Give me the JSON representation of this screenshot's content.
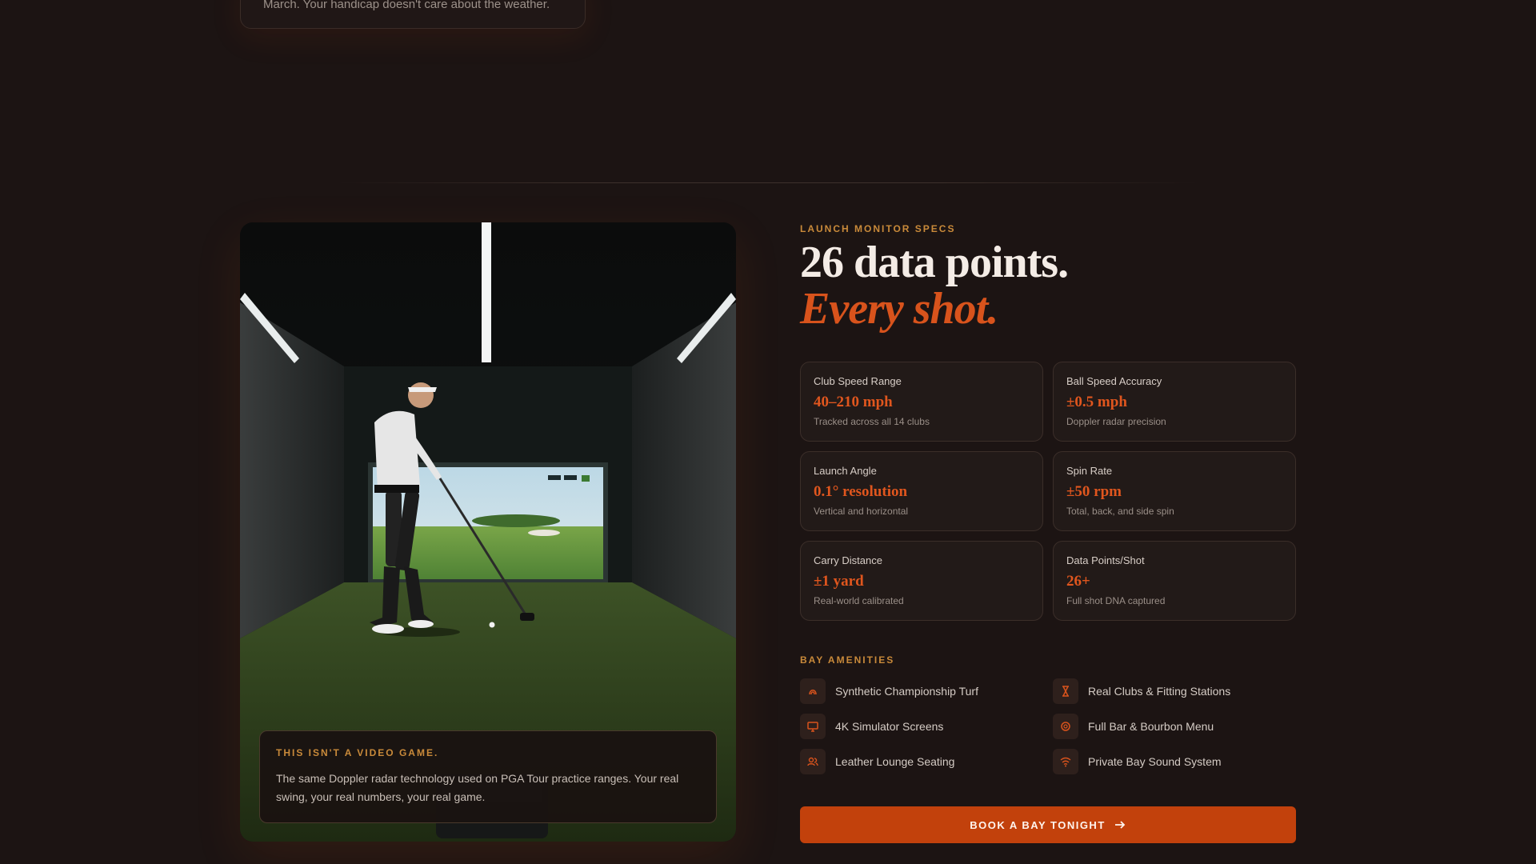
{
  "top_card": {
    "text": "March. Your handicap doesn't care about the weather."
  },
  "photo_callout": {
    "eyebrow": "THIS ISN'T A VIDEO GAME.",
    "body": "The same Doppler radar technology used on PGA Tour practice ranges. Your real swing, your real numbers, your real game."
  },
  "specs_section": {
    "eyebrow": "LAUNCH MONITOR SPECS",
    "headline": "26 data points.",
    "headline_accent": "Every shot.",
    "cards": [
      {
        "label": "Club Speed Range",
        "value": "40–210 mph",
        "sub": "Tracked across all 14 clubs"
      },
      {
        "label": "Ball Speed Accuracy",
        "value": "±0.5 mph",
        "sub": "Doppler radar precision"
      },
      {
        "label": "Launch Angle",
        "value": "0.1° resolution",
        "sub": "Vertical and horizontal"
      },
      {
        "label": "Spin Rate",
        "value": "±50 rpm",
        "sub": "Total, back, and side spin"
      },
      {
        "label": "Carry Distance",
        "value": "±1 yard",
        "sub": "Real-world calibrated"
      },
      {
        "label": "Data Points/Shot",
        "value": "26+",
        "sub": "Full shot DNA captured"
      }
    ]
  },
  "amenities": {
    "title": "BAY AMENITIES",
    "items": [
      {
        "label": "Synthetic Championship Turf",
        "icon": "turf-icon"
      },
      {
        "label": "Real Clubs & Fitting Stations",
        "icon": "hourglass-icon"
      },
      {
        "label": "4K Simulator Screens",
        "icon": "monitor-icon"
      },
      {
        "label": "Full Bar & Bourbon Menu",
        "icon": "drink-icon"
      },
      {
        "label": "Leather Lounge Seating",
        "icon": "users-icon"
      },
      {
        "label": "Private Bay Sound System",
        "icon": "wifi-icon"
      }
    ]
  },
  "cta": {
    "label": "BOOK A BAY TONIGHT"
  },
  "colors": {
    "accent": "#c2410c",
    "accent_text": "#e0561e",
    "eyebrow": "#c98a3a",
    "background": "#1c1413"
  }
}
